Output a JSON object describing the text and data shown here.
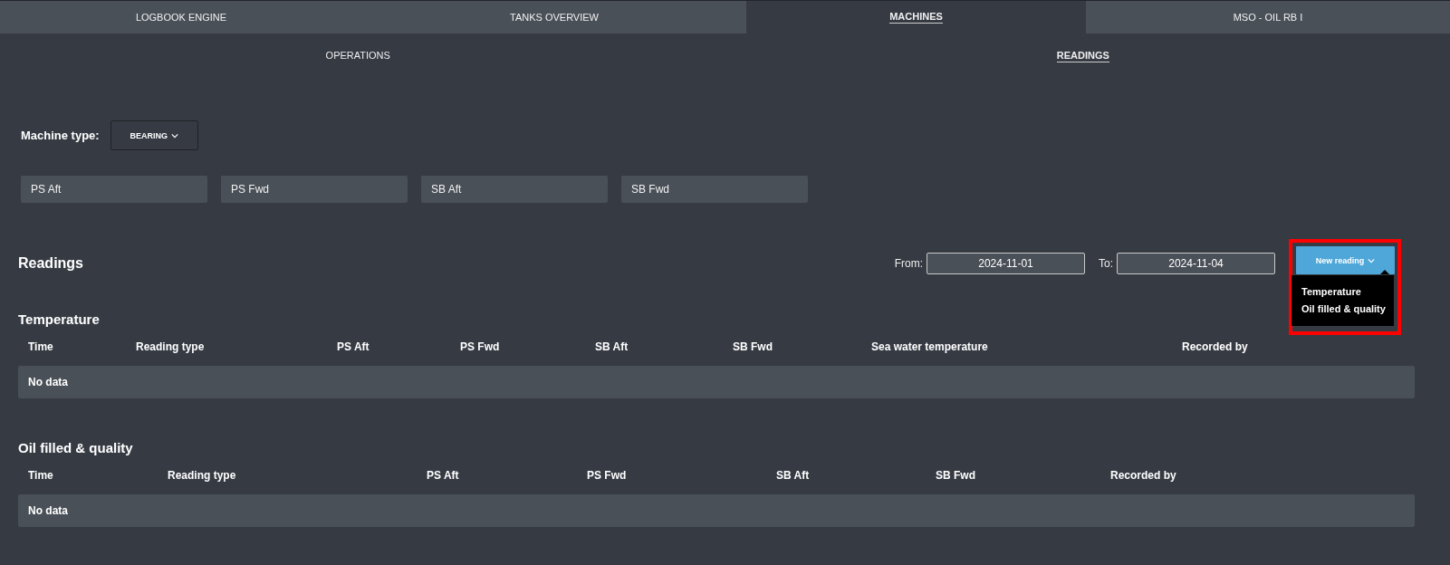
{
  "tabs": [
    {
      "label": "LOGBOOK ENGINE",
      "selected": false
    },
    {
      "label": "TANKS OVERVIEW",
      "selected": false
    },
    {
      "label": "MACHINES",
      "selected": true
    },
    {
      "label": "MSO - OIL RB I",
      "selected": false
    }
  ],
  "subtabs": [
    {
      "label": "OPERATIONS",
      "selected": false
    },
    {
      "label": "READINGS",
      "selected": true
    }
  ],
  "machine_type": {
    "label": "Machine type:",
    "value": "BEARING"
  },
  "machines": [
    "PS Aft",
    "PS Fwd",
    "SB Aft",
    "SB Fwd"
  ],
  "readings": {
    "title": "Readings",
    "from_label": "From:",
    "from": "2024-11-01",
    "to_label": "To:",
    "to": "2024-11-04",
    "new_button": "New reading",
    "menu": {
      "expanded": true,
      "items": [
        "Temperature",
        "Oil filled & quality"
      ]
    }
  },
  "tables": [
    {
      "title": "Temperature",
      "columns": [
        "Time",
        "Reading type",
        "PS Aft",
        "PS Fwd",
        "SB Aft",
        "SB Fwd",
        "Sea water temperature",
        "Recorded by"
      ],
      "empty": "No data"
    },
    {
      "title": "Oil filled & quality",
      "columns": [
        "Time",
        "Reading type",
        "PS Aft",
        "PS Fwd",
        "SB Aft",
        "SB Fwd",
        "Recorded by"
      ],
      "empty": "No data"
    }
  ]
}
